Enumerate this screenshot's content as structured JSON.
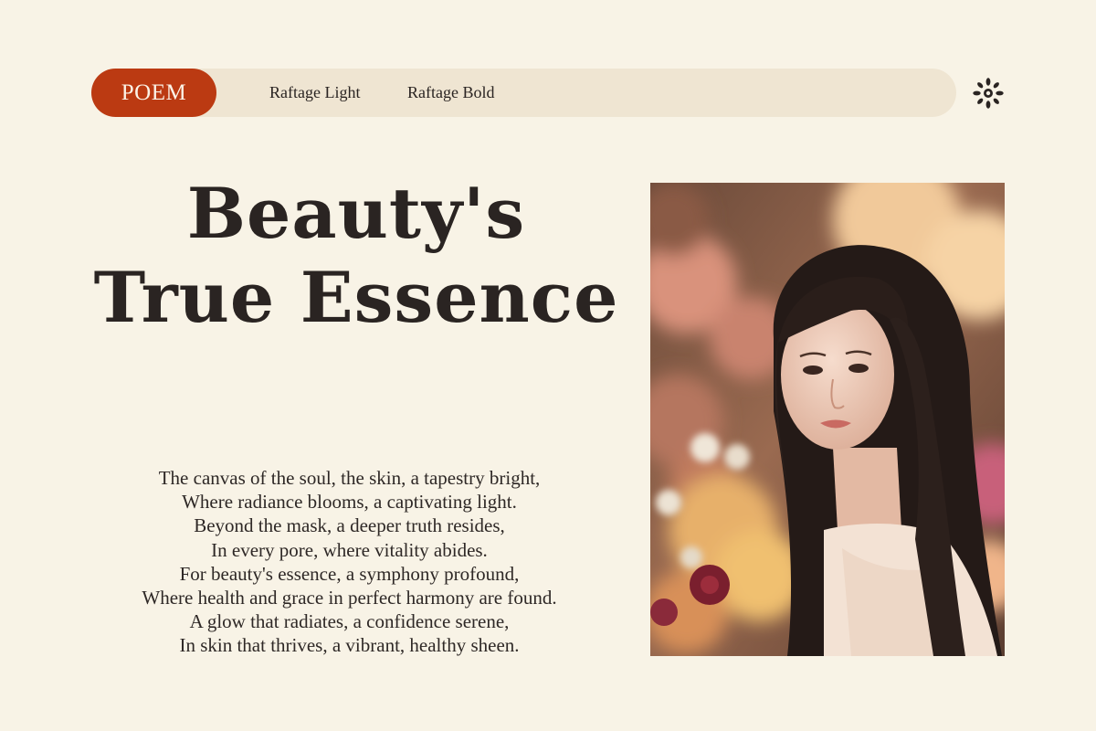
{
  "nav": {
    "active_label": "POEM",
    "links": [
      {
        "label": "Raftage Light"
      },
      {
        "label": "Raftage Bold"
      }
    ],
    "icon": "sun-flower-icon"
  },
  "title": {
    "lines": [
      "Beauty's",
      "True Essence"
    ]
  },
  "poem": {
    "lines": [
      "The canvas of the soul, the skin, a tapestry bright,",
      "Where radiance blooms, a captivating light.",
      "Beyond the mask, a deeper truth resides,",
      "In every pore, where vitality abides.",
      "For beauty's essence, a symphony profound,",
      "Where health and grace in perfect harmony are found.",
      "A glow that radiates, a confidence serene,",
      "In skin that thrives, a vibrant, healthy sheen."
    ]
  },
  "colors": {
    "background": "#f8f3e6",
    "nav_bar": "#efe5d2",
    "accent": "#bb3a12",
    "text": "#2a2422"
  }
}
